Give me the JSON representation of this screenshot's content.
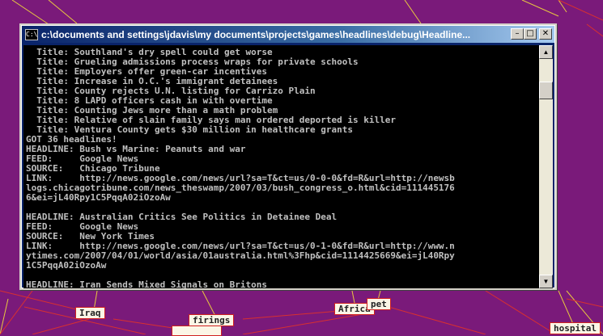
{
  "window": {
    "title": "c:\\documents and settings\\jdavis\\my documents\\projects\\games\\headlines\\debug\\Headline...",
    "controls": {
      "minimize": "–",
      "maximize": "□",
      "close": "✕"
    },
    "icon": "console-icon",
    "icon_text": "C:\\"
  },
  "console": {
    "lines": [
      "  Title: Southland's dry spell could get worse",
      "  Title: Grueling admissions process wraps for private schools",
      "  Title: Employers offer green-car incentives",
      "  Title: Increase in O.C.'s immigrant detainees",
      "  Title: County rejects U.N. listing for Carrizo Plain",
      "  Title: 8 LAPD officers cash in with overtime",
      "  Title: Counting Jews more than a math problem",
      "  Title: Relative of slain family says man ordered deported is killer",
      "  Title: Ventura County gets $30 million in healthcare grants",
      "GOT 36 headlines!",
      "HEADLINE: Bush vs Marine: Peanuts and war",
      "FEED:     Google News",
      "SOURCE:   Chicago Tribune",
      "LINK:     http://news.google.com/news/url?sa=T&ct=us/0-0-0&fd=R&url=http://newsb",
      "logs.chicagotribune.com/news_theswamp/2007/03/bush_congress_o.html&cid=111445176",
      "6&ei=jL40Rpy1C5PqqA02iOzoAw",
      "",
      "HEADLINE: Australian Critics See Politics in Detainee Deal",
      "FEED:     Google News",
      "SOURCE:   New York Times",
      "LINK:     http://news.google.com/news/url?sa=T&ct=us/0-1-0&fd=R&url=http://www.n",
      "ytimes.com/2007/04/01/world/asia/01australia.html%3Fhp&cid=1114425669&ei=jL40Rpy",
      "1C5PqqA02iOzoAw",
      "",
      "HEADLINE: Iran Sends Mixed Signals on Britons"
    ]
  },
  "scrollbar": {
    "up_arrow": "▲",
    "down_arrow": "▼"
  },
  "background_tags": [
    {
      "label": "Iraq"
    },
    {
      "label": "firings"
    },
    {
      "label": "Africa"
    },
    {
      "label": "pet"
    },
    {
      "label": "hospital"
    }
  ],
  "colors": {
    "desktop_background": "#7a1a7a",
    "console_text": "#c0c0c0",
    "title_bar_start": "#0a246a",
    "title_bar_end": "#a6caf0"
  }
}
